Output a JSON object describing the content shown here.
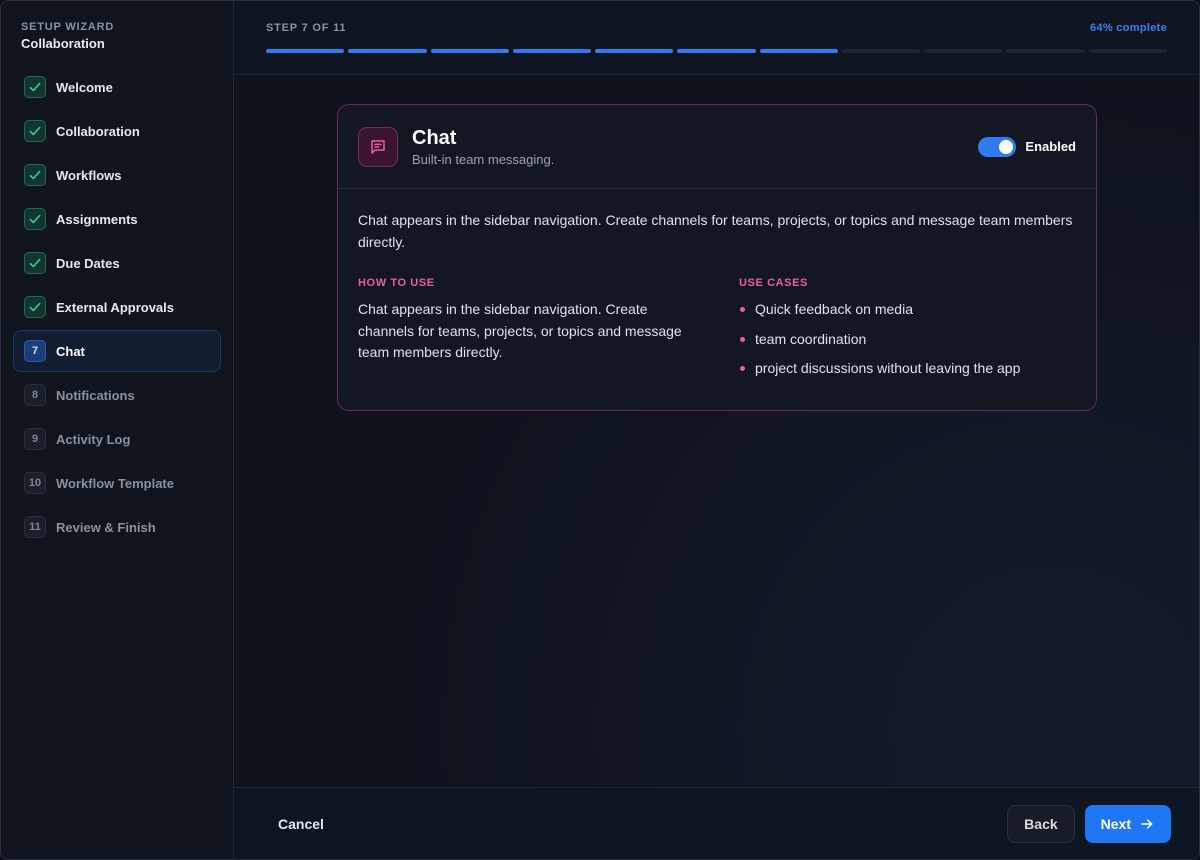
{
  "sidebar": {
    "eyebrow": "SETUP WIZARD",
    "title": "Collaboration",
    "steps": [
      {
        "num": "1",
        "label": "Welcome",
        "state": "done"
      },
      {
        "num": "2",
        "label": "Collaboration",
        "state": "done"
      },
      {
        "num": "3",
        "label": "Workflows",
        "state": "done"
      },
      {
        "num": "4",
        "label": "Assignments",
        "state": "done"
      },
      {
        "num": "5",
        "label": "Due Dates",
        "state": "done"
      },
      {
        "num": "6",
        "label": "External Approvals",
        "state": "done"
      },
      {
        "num": "7",
        "label": "Chat",
        "state": "active"
      },
      {
        "num": "8",
        "label": "Notifications",
        "state": "todo"
      },
      {
        "num": "9",
        "label": "Activity Log",
        "state": "todo"
      },
      {
        "num": "10",
        "label": "Workflow Template",
        "state": "todo"
      },
      {
        "num": "11",
        "label": "Review & Finish",
        "state": "todo"
      }
    ]
  },
  "header": {
    "step_text": "STEP 7 OF 11",
    "percent_text": "64% complete",
    "segments_total": 11,
    "segments_done": 7
  },
  "card": {
    "icon": "chat-bubble-icon",
    "title": "Chat",
    "subtitle": "Built-in team messaging.",
    "toggle_label": "Enabled",
    "toggle_on": true,
    "description": "Chat appears in the sidebar navigation. Create channels for teams, projects, or topics and message team members directly.",
    "how_to_use_heading": "HOW TO USE",
    "how_to_use_text": "Chat appears in the sidebar navigation. Create channels for teams, projects, or topics and message team members directly.",
    "use_cases_heading": "USE CASES",
    "use_cases": [
      "Quick feedback on media",
      "team coordination",
      "project discussions without leaving the app"
    ]
  },
  "footer": {
    "cancel_label": "Cancel",
    "back_label": "Back",
    "next_label": "Next"
  },
  "colors": {
    "accent_blue": "#2f7cf0",
    "accent_pink": "#ec5fa6",
    "done_green": "#1e6b57"
  }
}
